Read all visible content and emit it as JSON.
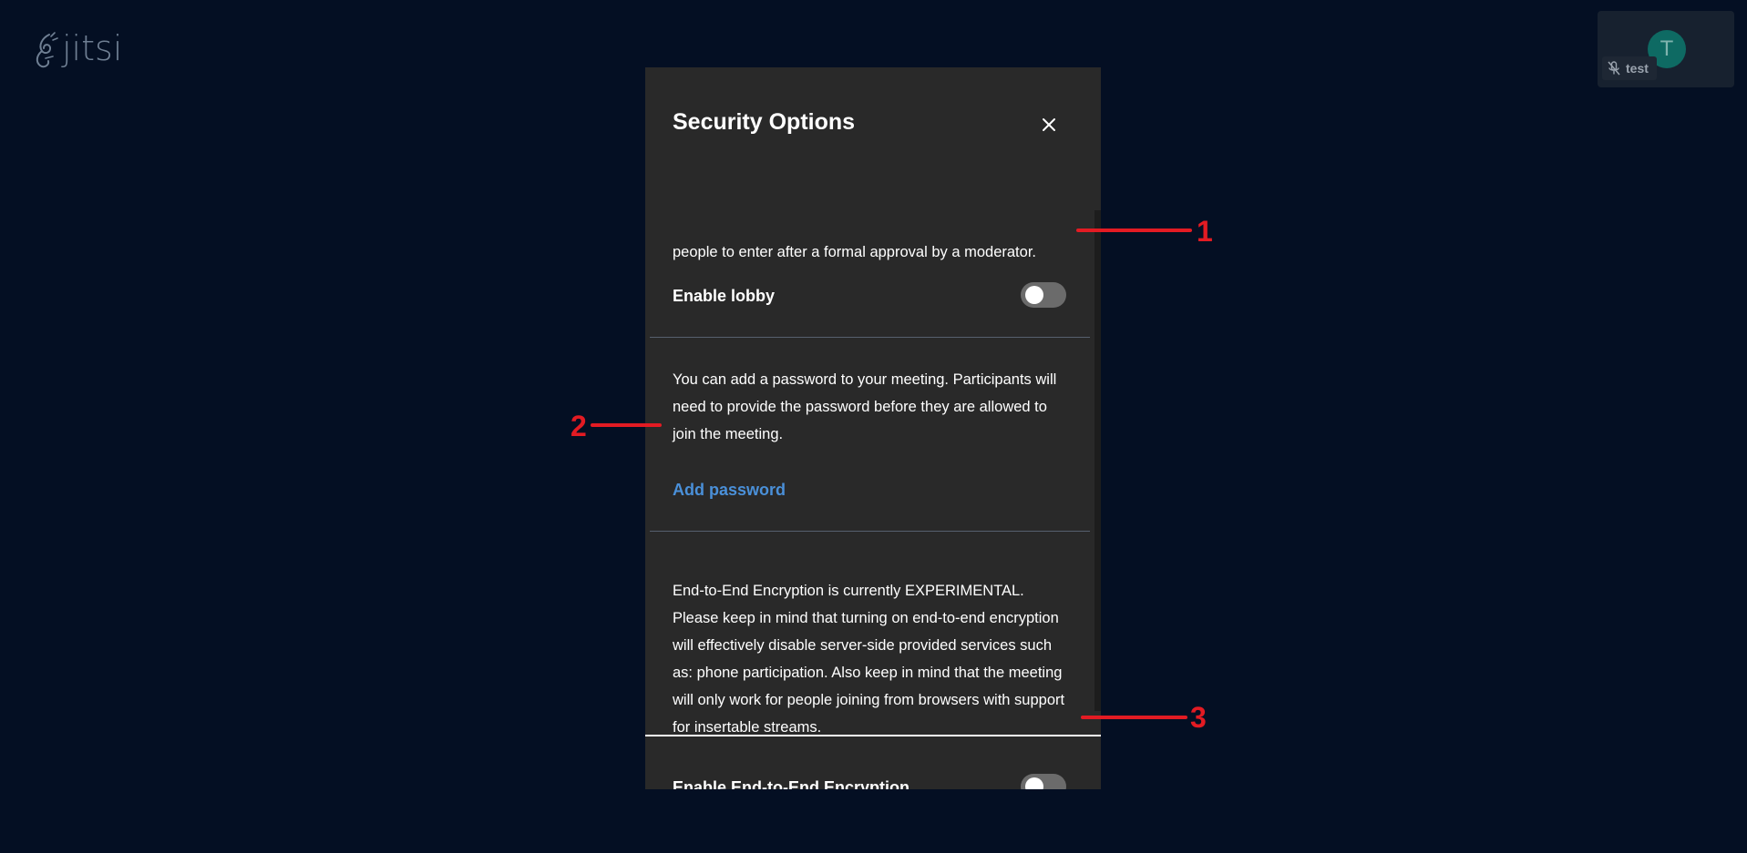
{
  "app": {
    "logo_text": "jitsi"
  },
  "participant": {
    "avatar_initial": "T",
    "name": "test",
    "mic_state": "muted"
  },
  "dialog": {
    "title": "Security Options",
    "close_icon": "close-icon",
    "lobby": {
      "description_tail": "people to enter after a formal approval by a moderator.",
      "toggle_label": "Enable lobby",
      "enabled": false
    },
    "password": {
      "description_lines": [
        "You can add a password to your meeting. Participants will",
        "need to provide the password before they are allowed to",
        "join the meeting."
      ],
      "add_password_label": "Add password"
    },
    "e2ee": {
      "description_lines": [
        "End-to-End Encryption is currently EXPERIMENTAL.",
        "Please keep in mind that turning on end-to-end encryption",
        "will effectively disable server-side provided services such",
        "as: phone participation. Also keep in mind that the meeting",
        "will only work for people joining from browsers with support",
        "for insertable streams."
      ],
      "toggle_label": "Enable End-to-End Encryption",
      "enabled": false
    }
  },
  "annotations": {
    "marker_1": "1",
    "marker_2": "2",
    "marker_3": "3",
    "color": "#e31b23"
  },
  "colors": {
    "background": "#040f23",
    "dialog": "#292929",
    "link": "#4a90d9",
    "toggle_off": "#6b6b6b"
  }
}
